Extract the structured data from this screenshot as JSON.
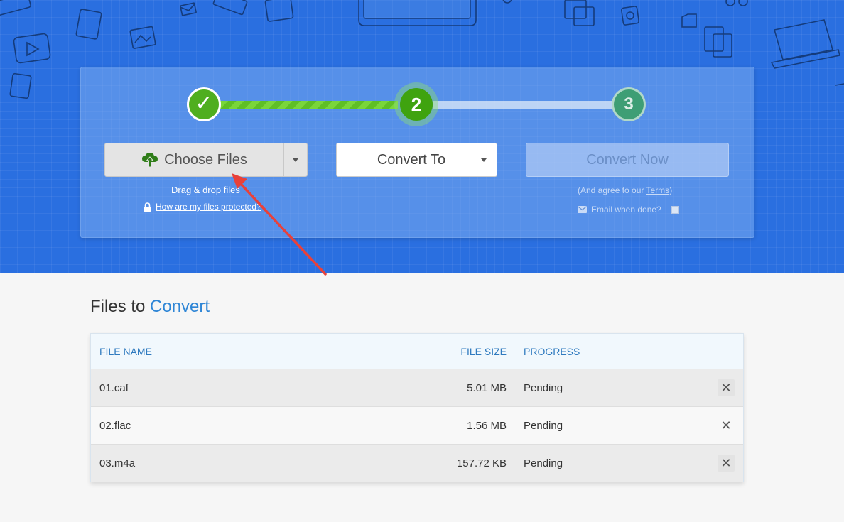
{
  "steps": {
    "step1_symbol": "✓",
    "step2_number": "2",
    "step3_number": "3"
  },
  "upload": {
    "choose_files_label": "Choose Files",
    "choose_files_icon": "cloud-upload-icon",
    "drag_drop_note": "Drag & drop files",
    "protected_link": "How are my files protected?"
  },
  "convert_to": {
    "label": "Convert To"
  },
  "convert_now": {
    "label": "Convert Now",
    "agree_prefix": "(And agree to our ",
    "terms_link": "Terms",
    "agree_suffix": ")",
    "email_label": "Email when done?"
  },
  "files": {
    "title_prefix": "Files to ",
    "title_accent": "Convert",
    "columns": [
      "FILE NAME",
      "FILE SIZE",
      "PROGRESS"
    ],
    "rows": [
      {
        "name": "01.caf",
        "size": "5.01 MB",
        "progress": "Pending"
      },
      {
        "name": "02.flac",
        "size": "1.56 MB",
        "progress": "Pending"
      },
      {
        "name": "03.m4a",
        "size": "157.72 KB",
        "progress": "Pending"
      }
    ],
    "remove_symbol": "✕"
  },
  "colors": {
    "hero_blue": "#2a6fe0",
    "step_green": "#3fa30f",
    "accent_blue": "#2f86d6",
    "annotation_red": "#e8413a"
  }
}
